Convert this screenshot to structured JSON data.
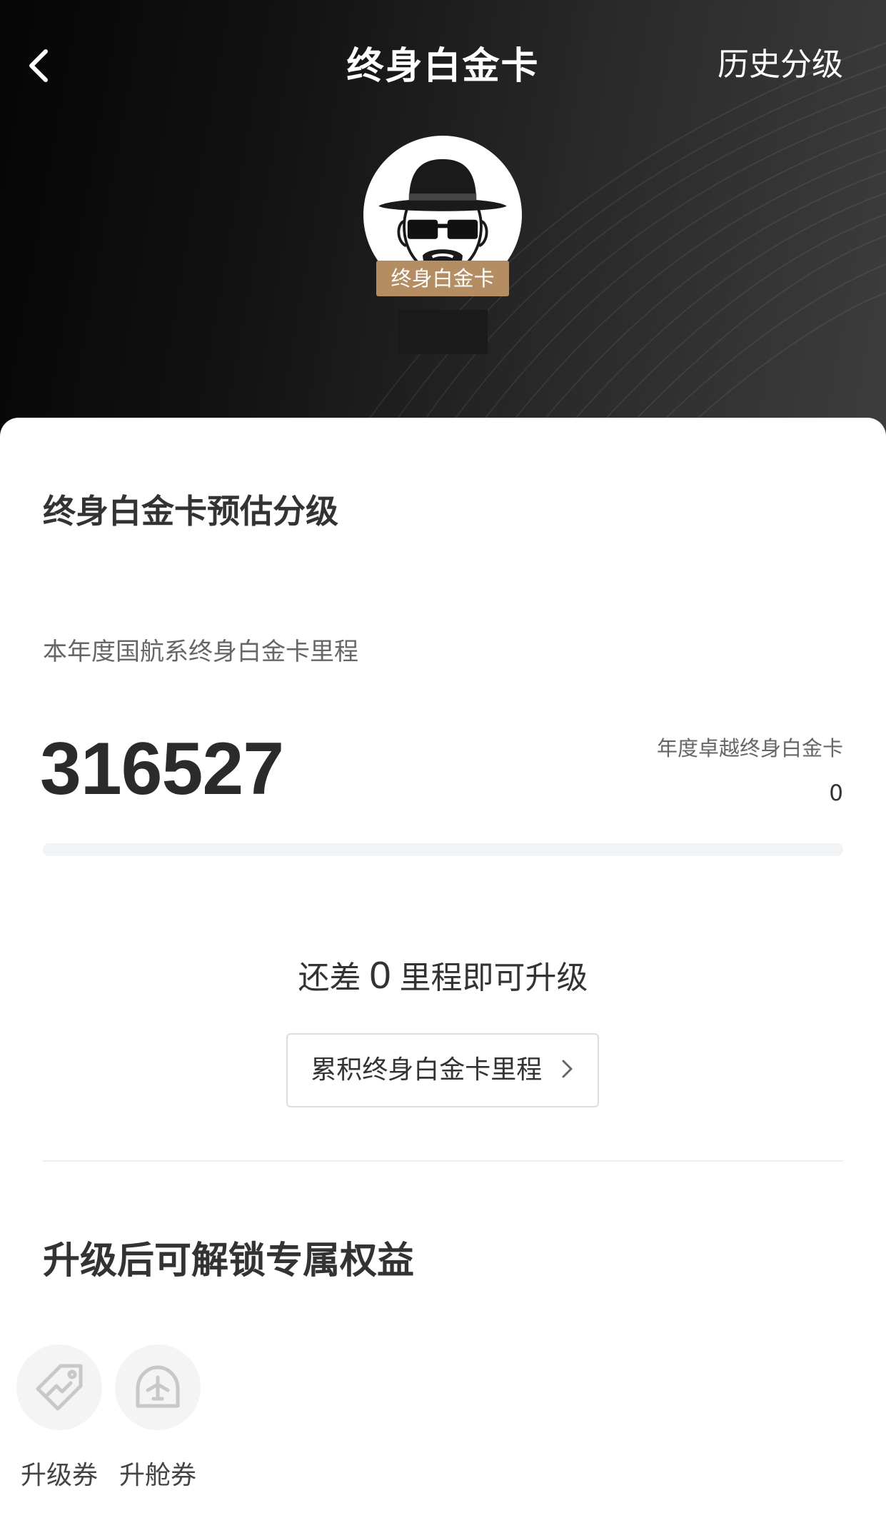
{
  "header": {
    "title": "终身白金卡",
    "history_link": "历史分级",
    "tier_badge": "终身白金卡"
  },
  "card": {
    "section_title": "终身白金卡预估分级",
    "miles_label": "本年度国航系终身白金卡里程",
    "miles_value": "316527",
    "target_label": "年度卓越终身白金卡",
    "target_value": "0",
    "progress_fraction": 0,
    "remaining_prefix": "还差",
    "remaining_value": "0",
    "remaining_suffix": "里程即可升级",
    "accumulate_button": "累积终身白金卡里程"
  },
  "benefits": {
    "title": "升级后可解锁专属权益",
    "items": [
      {
        "label": "升级券",
        "icon": "upgrade-coupon-icon"
      },
      {
        "label": "升舱券",
        "icon": "cabin-upgrade-icon"
      }
    ]
  },
  "colors": {
    "badge_gold": "#b48d62",
    "text_dark": "#333333",
    "text_muted": "#666666",
    "track": "#f2f3f5"
  }
}
